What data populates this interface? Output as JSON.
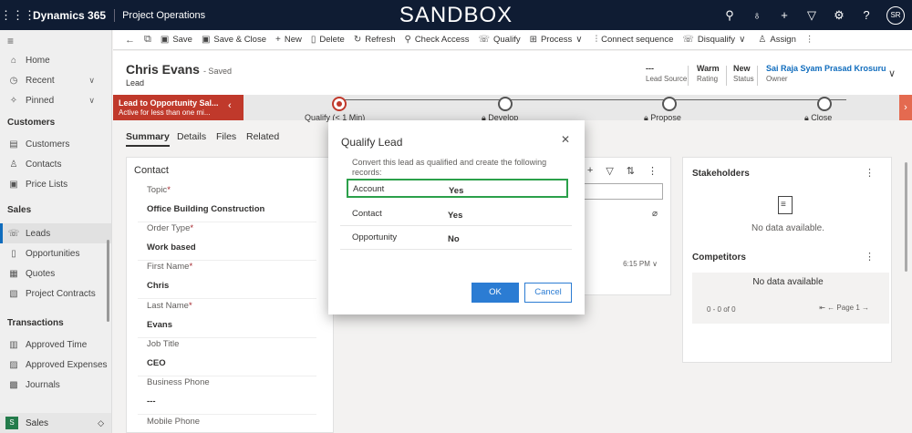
{
  "topbar": {
    "app_name": "Dynamics 365",
    "module": "Project Operations",
    "environment": "SANDBOX",
    "user_initials": "SR",
    "icons": [
      "search-icon",
      "lightbulb-icon",
      "plus-icon",
      "filter-icon",
      "settings-icon",
      "help-icon"
    ]
  },
  "sidebar": {
    "items_top": [
      {
        "label": "Home",
        "icon": "home-icon"
      },
      {
        "label": "Recent",
        "icon": "clock-icon",
        "chevron": true
      },
      {
        "label": "Pinned",
        "icon": "pin-icon",
        "chevron": true
      }
    ],
    "groups": [
      {
        "title": "Customers",
        "items": [
          {
            "label": "Customers",
            "icon": "building-icon"
          },
          {
            "label": "Contacts",
            "icon": "person-icon"
          },
          {
            "label": "Price Lists",
            "icon": "list-icon"
          }
        ]
      },
      {
        "title": "Sales",
        "items": [
          {
            "label": "Leads",
            "icon": "phone-icon",
            "active": true
          },
          {
            "label": "Opportunities",
            "icon": "document-icon"
          },
          {
            "label": "Quotes",
            "icon": "quote-icon"
          },
          {
            "label": "Project Contracts",
            "icon": "contract-icon"
          }
        ]
      },
      {
        "title": "Transactions",
        "items": [
          {
            "label": "Approved Time",
            "icon": "calendar-icon"
          },
          {
            "label": "Approved Expenses",
            "icon": "receipt-icon"
          },
          {
            "label": "Journals",
            "icon": "journal-icon"
          }
        ]
      }
    ],
    "footer": {
      "badge": "S",
      "label": "Sales"
    }
  },
  "commandbar": {
    "items": [
      {
        "label": "Save",
        "icon": "save-icon"
      },
      {
        "label": "Save & Close",
        "icon": "save-close-icon"
      },
      {
        "label": "New",
        "icon": "plus-icon"
      },
      {
        "label": "Delete",
        "icon": "trash-icon"
      },
      {
        "label": "Refresh",
        "icon": "refresh-icon"
      },
      {
        "label": "Check Access",
        "icon": "check-access-icon"
      },
      {
        "label": "Qualify",
        "icon": "qualify-icon"
      },
      {
        "label": "Process",
        "icon": "process-icon"
      },
      {
        "label": "Connect sequence",
        "icon": "sequence-icon"
      },
      {
        "label": "Disqualify",
        "icon": "disqualify-icon"
      },
      {
        "label": "Assign",
        "icon": "assign-icon"
      }
    ]
  },
  "header": {
    "name": "Chris Evans",
    "saved": "- Saved",
    "entity": "Lead",
    "lead_source_value": "---",
    "lead_source_label": "Lead Source",
    "rating_value": "Warm",
    "rating_label": "Rating",
    "status_value": "New",
    "status_label": "Status",
    "owner_value": "Sai Raja Syam Prasad Krosuru",
    "owner_label": "Owner"
  },
  "bpf": {
    "active_title": "Lead to Opportunity Sal...",
    "active_sub": "Active for less than one mi...",
    "stages": [
      "Qualify  (< 1 Min)",
      "Develop",
      "Propose",
      "Close"
    ]
  },
  "tabs": [
    "Summary",
    "Details",
    "Files",
    "Related"
  ],
  "form": {
    "section": "Contact",
    "fields": [
      {
        "label": "Topic",
        "required": true,
        "value": "Office Building Construction"
      },
      {
        "label": "Order Type",
        "required": true,
        "value": "Work based"
      },
      {
        "label": "First Name",
        "required": true,
        "value": "Chris"
      },
      {
        "label": "Last Name",
        "required": true,
        "value": "Evans"
      },
      {
        "label": "Job Title",
        "required": false,
        "value": "CEO"
      },
      {
        "label": "Business Phone",
        "required": false,
        "value": "---"
      },
      {
        "label": "Mobile Phone",
        "required": false,
        "value": ""
      }
    ]
  },
  "timeline": {
    "time": "6:15 PM"
  },
  "right": {
    "stakeholders_title": "Stakeholders",
    "stakeholders_empty": "No data available.",
    "competitors_title": "Competitors",
    "competitors_empty": "No data available",
    "pager": "0 - 0 of 0",
    "page": "Page 1"
  },
  "dialog": {
    "title": "Qualify Lead",
    "description": "Convert this lead as qualified and create the following records:",
    "rows": [
      {
        "label": "Account",
        "value": "Yes"
      },
      {
        "label": "Contact",
        "value": "Yes"
      },
      {
        "label": "Opportunity",
        "value": "No"
      }
    ],
    "ok": "OK",
    "cancel": "Cancel"
  }
}
